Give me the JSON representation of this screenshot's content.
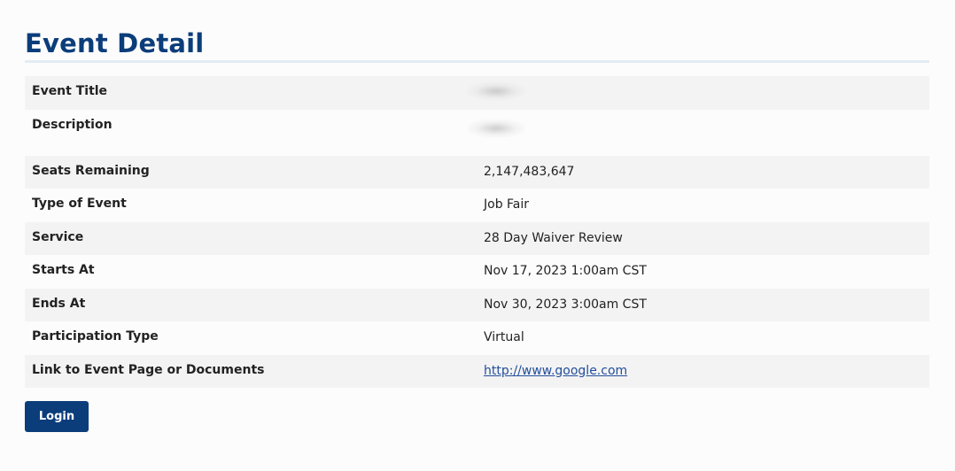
{
  "page_title": "Event Detail",
  "rows": [
    {
      "label": "Event Title",
      "value": "",
      "redacted": true
    },
    {
      "label": "Description",
      "value": "",
      "redacted": true
    },
    {
      "label": "Seats Remaining",
      "value": "2,147,483,647"
    },
    {
      "label": "Type of Event",
      "value": "Job Fair"
    },
    {
      "label": "Service",
      "value": "28 Day Waiver Review"
    },
    {
      "label": "Starts At",
      "value": "Nov 17, 2023 1:00am CST"
    },
    {
      "label": "Ends At",
      "value": "Nov 30, 2023 3:00am CST"
    },
    {
      "label": "Participation Type",
      "value": "Virtual"
    },
    {
      "label": "Link to Event Page or Documents",
      "value": "http://www.google.com",
      "is_link": true
    }
  ],
  "login_button": {
    "label": "Login"
  },
  "colors": {
    "title": "#0b3d7a",
    "button_bg": "#0b3d7a",
    "link": "#234f9c",
    "row_shade": "#f3f3f3"
  }
}
